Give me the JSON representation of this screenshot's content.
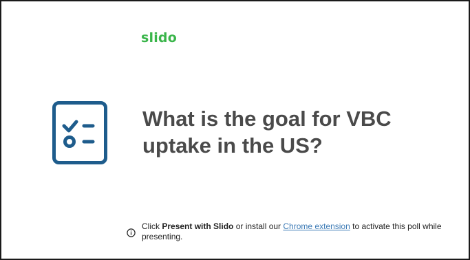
{
  "brand": {
    "name": "slido",
    "color": "#3ab54a"
  },
  "poll": {
    "question": "What is the goal for VBC uptake in the US?",
    "icon": "poll-checklist-icon",
    "icon_color": "#1e5c8c"
  },
  "footer": {
    "info_icon": "info-icon",
    "text_prefix": "Click ",
    "present_label": "Present with Slido",
    "text_middle": " or install our ",
    "extension_link": "Chrome extension",
    "text_suffix": " to activate this poll while presenting.",
    "link_color": "#3d7bb6"
  }
}
